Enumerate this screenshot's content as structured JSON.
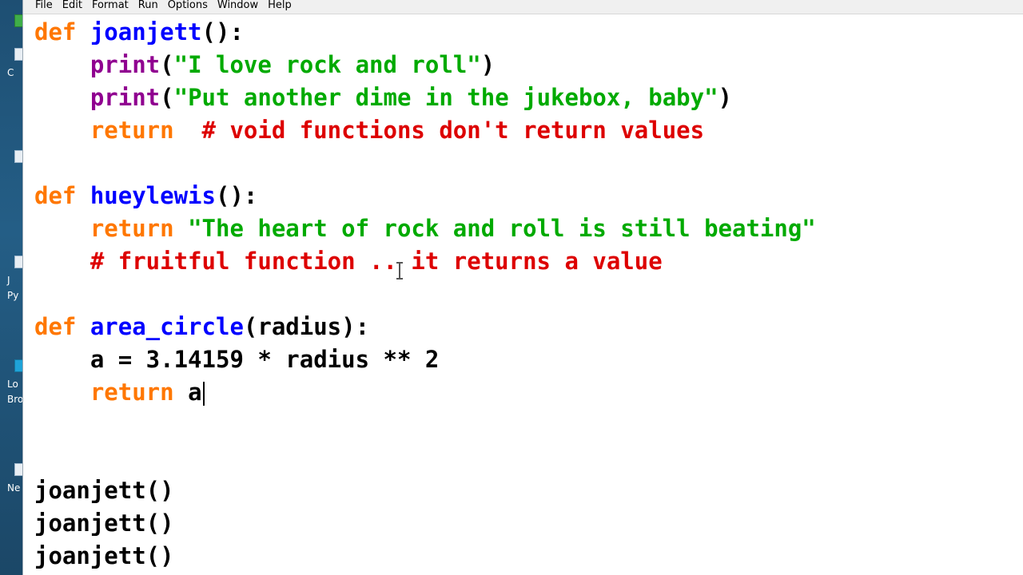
{
  "menu": [
    "File",
    "Edit",
    "Format",
    "Run",
    "Options",
    "Window",
    "Help"
  ],
  "desktop_labels": [
    "C",
    "J",
    "Py",
    "Lo",
    "Bro",
    "Ne"
  ],
  "code_lines": [
    {
      "indent": "",
      "parts": [
        [
          "kw",
          "def "
        ],
        [
          "fn",
          "joanjett"
        ],
        [
          "plain",
          "():"
        ]
      ]
    },
    {
      "indent": "    ",
      "parts": [
        [
          "bi",
          "print"
        ],
        [
          "plain",
          "("
        ],
        [
          "str",
          "\"I love rock and roll\""
        ],
        [
          "plain",
          ")"
        ]
      ]
    },
    {
      "indent": "    ",
      "parts": [
        [
          "bi",
          "print"
        ],
        [
          "plain",
          "("
        ],
        [
          "str",
          "\"Put another dime in the jukebox, baby\""
        ],
        [
          "plain",
          ")"
        ]
      ]
    },
    {
      "indent": "    ",
      "parts": [
        [
          "kw",
          "return"
        ],
        [
          "plain",
          "  "
        ],
        [
          "cm",
          "# void functions don't return values"
        ]
      ]
    },
    {
      "indent": "",
      "parts": []
    },
    {
      "indent": "",
      "parts": [
        [
          "kw",
          "def "
        ],
        [
          "fn",
          "hueylewis"
        ],
        [
          "plain",
          "():"
        ]
      ]
    },
    {
      "indent": "    ",
      "parts": [
        [
          "kw",
          "return "
        ],
        [
          "str",
          "\"The heart of rock and roll is still beating\""
        ]
      ]
    },
    {
      "indent": "    ",
      "parts": [
        [
          "cm",
          "# fruitful function .. it returns a value"
        ]
      ]
    },
    {
      "indent": "",
      "parts": []
    },
    {
      "indent": "",
      "parts": [
        [
          "kw",
          "def "
        ],
        [
          "fn",
          "area_circle"
        ],
        [
          "plain",
          "(radius):"
        ]
      ]
    },
    {
      "indent": "    ",
      "parts": [
        [
          "plain",
          "a = 3.14159 * radius ** 2"
        ]
      ]
    },
    {
      "indent": "    ",
      "parts": [
        [
          "kw",
          "return "
        ],
        [
          "plain",
          "a"
        ]
      ]
    },
    {
      "indent": "",
      "parts": []
    },
    {
      "indent": "",
      "parts": []
    },
    {
      "indent": "",
      "parts": [
        [
          "plain",
          "joanjett()"
        ]
      ]
    },
    {
      "indent": "",
      "parts": [
        [
          "plain",
          "joanjett()"
        ]
      ]
    },
    {
      "indent": "",
      "parts": [
        [
          "plain",
          "joanjett()"
        ]
      ]
    }
  ],
  "caret": {
    "line": 11
  }
}
